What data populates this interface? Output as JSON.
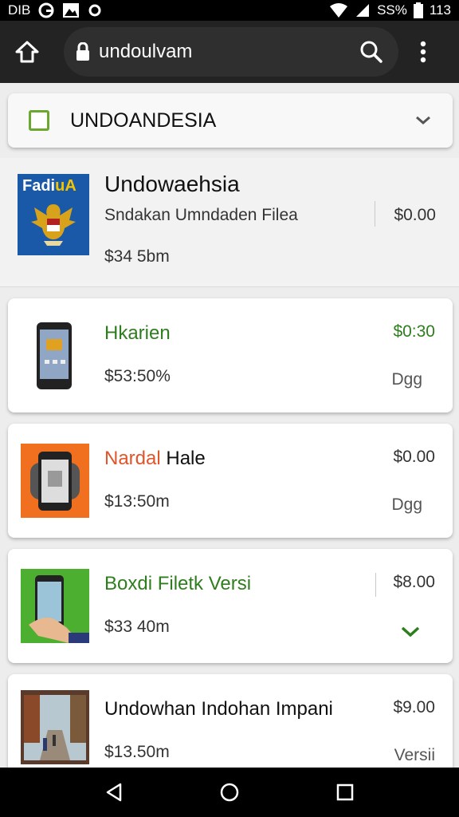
{
  "status_bar": {
    "left_text": "DIB",
    "battery_percent": "SS%",
    "time": "113",
    "icons": [
      "g-icon",
      "image-icon",
      "circle-icon",
      "wifi-icon",
      "signal-icon",
      "battery-icon"
    ]
  },
  "browser": {
    "url": "undoulvam",
    "icons": [
      "home-icon",
      "lock-icon",
      "search-icon",
      "more-vert-icon"
    ]
  },
  "filter": {
    "label": "UNDOANDESIA",
    "checkbox_color": "#6aa830"
  },
  "featured": {
    "logo_text_main": "Fadi",
    "logo_text_accent": "uA",
    "title": "Undowaehsia",
    "subtitle": "Sndakan Umndaden Filea",
    "amount": "$34 5bm",
    "price": "$0.00"
  },
  "items": [
    {
      "title": "Hkarien",
      "title_color": "#2e7d1e",
      "amount": "$53:50%",
      "price": "$0:30",
      "price_color": "#2e7d1e",
      "extra": "Dgg"
    },
    {
      "title_colored": "Nardal",
      "title_color": "#e0552a",
      "title_rest": "Hale",
      "amount": "$13:50m",
      "price": "$0.00",
      "extra": "Dgg"
    },
    {
      "title": "Boxdi Filetk Versi",
      "title_color": "#2e7d1e",
      "amount": "$33 40m",
      "price": "$8.00",
      "extra_icon": "chevron-down-icon"
    },
    {
      "title": "Undowhan Indohan Impani",
      "title_color": "#111111",
      "amount": "$13.50m",
      "price": "$9.00",
      "extra": "Versii"
    }
  ],
  "nav": {
    "icons": [
      "back-icon",
      "home-circle-icon",
      "recents-icon"
    ]
  }
}
